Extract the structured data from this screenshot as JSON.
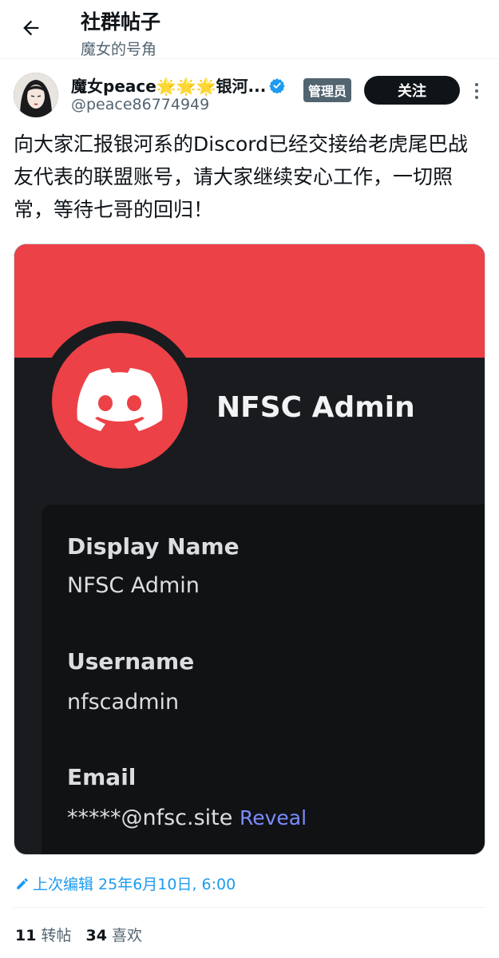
{
  "header": {
    "title": "社群帖子",
    "subtitle": "魔女的号角"
  },
  "author": {
    "display_name": "魔女peace🌟🌟🌟银河...",
    "handle": "@peace86774949",
    "role_badge": "管理员"
  },
  "follow_label": "关注",
  "post": {
    "text": "向大家汇报银河系的Discord已经交接给老虎尾巴战友代表的联盟账号，请大家继续安心工作，一切照常，等待七哥的回归！"
  },
  "discord_card": {
    "name": "NFSC Admin",
    "fields": [
      {
        "label": "Display Name",
        "value": "NFSC Admin"
      },
      {
        "label": "Username",
        "value": "nfscadmin"
      },
      {
        "label": "Email",
        "value": "*****@nfsc.site"
      }
    ],
    "reveal_label": "Reveal"
  },
  "edit_info": "上次编辑 25年6月10日, 6:00",
  "stats": {
    "reposts_count": "11",
    "reposts_label": "转帖",
    "likes_count": "34",
    "likes_label": "喜欢"
  },
  "colors": {
    "discord_red": "#ec4146",
    "link_blue": "#1d9bf0",
    "discord_dark": "#1a1b1e"
  }
}
